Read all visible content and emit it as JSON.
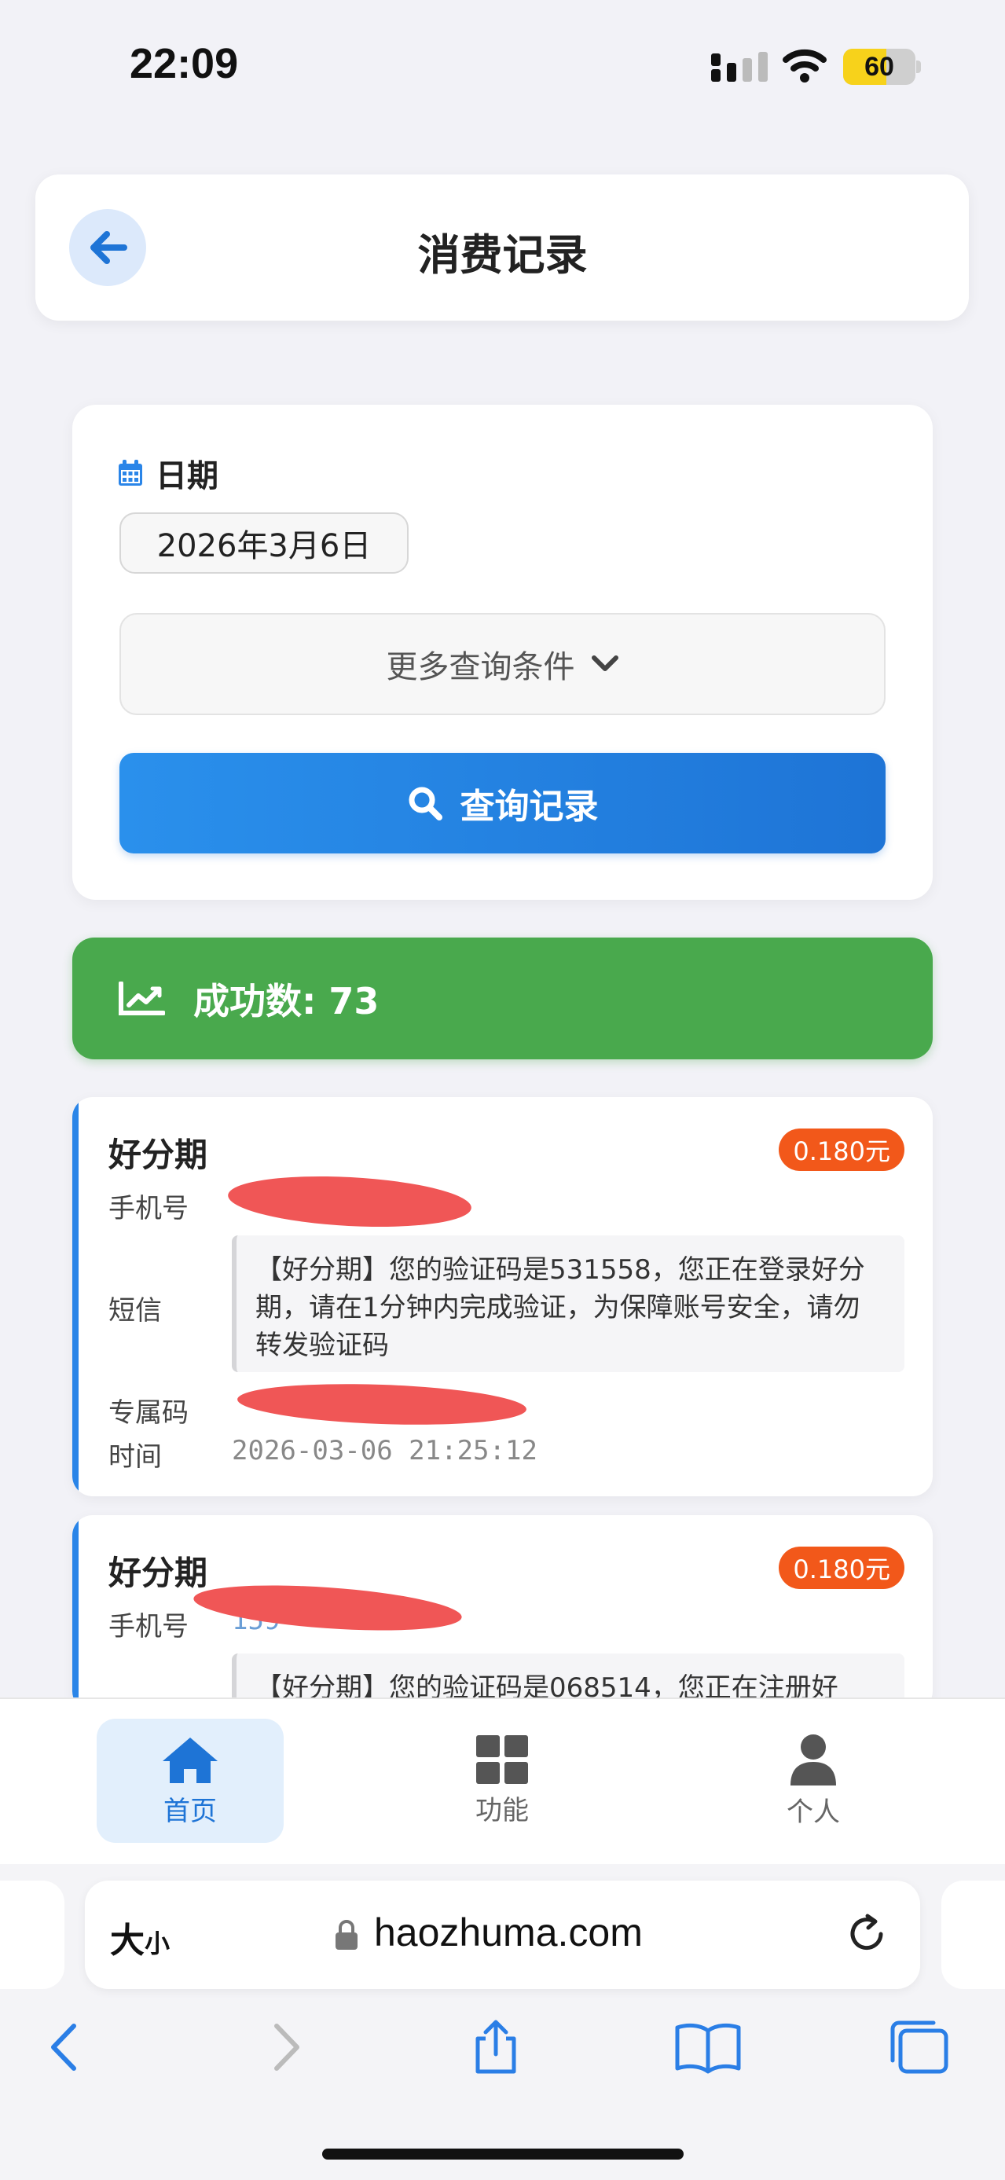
{
  "status_bar": {
    "time": "22:09",
    "battery": "60"
  },
  "header": {
    "title": "消费记录"
  },
  "query": {
    "date_label": "日期",
    "date_value": "2026年3月6日",
    "more_filters": "更多查询条件",
    "search_button": "查询记录"
  },
  "summary": {
    "success_text": "成功数: 73"
  },
  "records": [
    {
      "name": "好分期",
      "price": "0.180元",
      "phone_label": "手机号",
      "phone": "",
      "sms_label": "短信",
      "sms": "【好分期】您的验证码是531558，您正在登录好分期，请在1分钟内完成验证，为保障账号安全，请勿转发验证码",
      "code_label": "专属码",
      "code": "",
      "time_label": "时间",
      "time": "2026-03-06 21:25:12"
    },
    {
      "name": "好分期",
      "price": "0.180元",
      "phone_label": "手机号",
      "phone": "159",
      "sms": "【好分期】您的验证码是068514，您正在注册好"
    }
  ],
  "tabbar": {
    "home": "首页",
    "functions": "功能",
    "profile": "个人"
  },
  "browser": {
    "text_size": "大",
    "text_size_small": "小",
    "url": "haozhuma.com"
  },
  "colors": {
    "primary": "#1e74d6",
    "success": "#49a94d",
    "price_badge": "#f2581a"
  }
}
